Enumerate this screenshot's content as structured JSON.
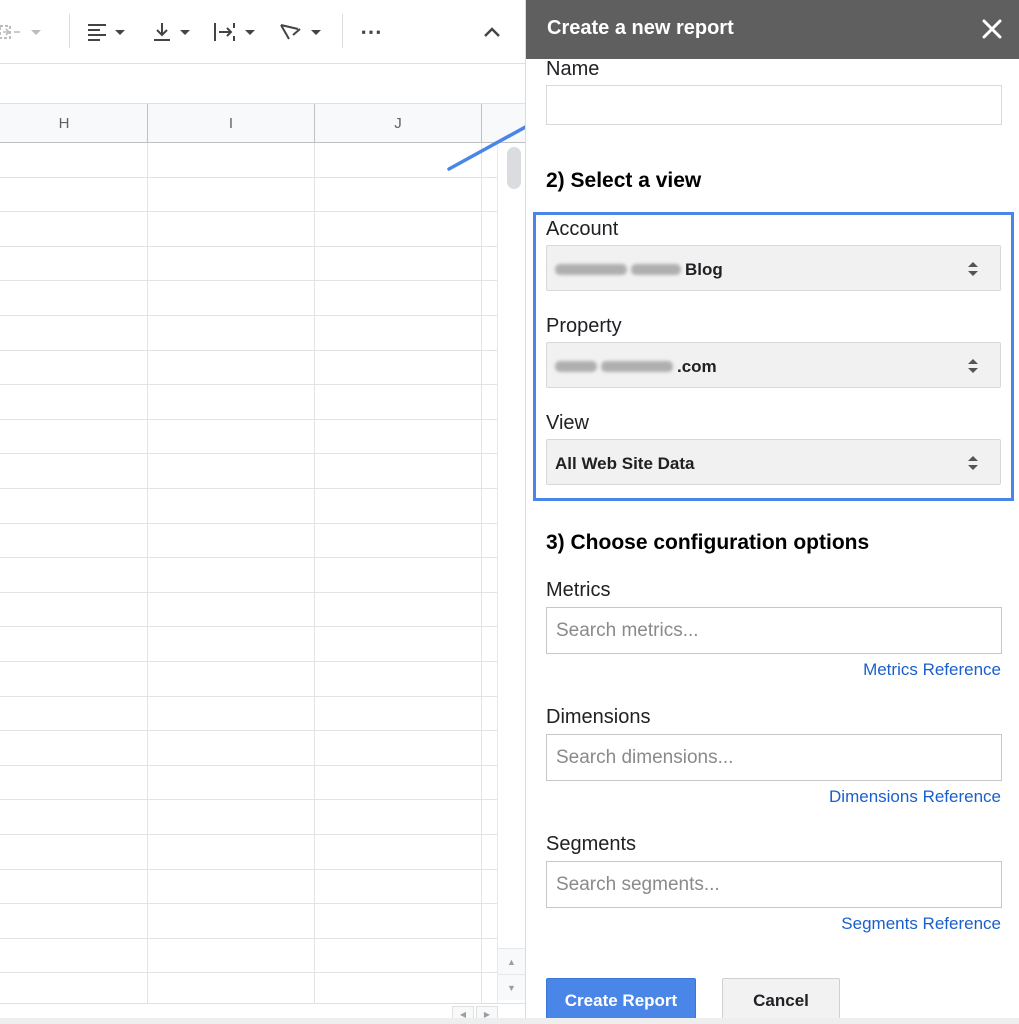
{
  "toolbar": {
    "items": [
      {
        "icon": "merge-cells-icon"
      },
      {
        "icon": "horizontal-align-icon"
      },
      {
        "icon": "vertical-align-icon"
      },
      {
        "icon": "text-wrapping-icon"
      },
      {
        "icon": "text-rotation-icon"
      },
      {
        "icon": "more-options-icon"
      },
      {
        "icon": "collapse-toolbar-icon"
      }
    ],
    "more_label": "⋯"
  },
  "sheet": {
    "columns": [
      "H",
      "I",
      "J"
    ],
    "row_count": 25
  },
  "panel": {
    "title": "Create a new report",
    "close_icon": "close-icon",
    "name": {
      "label": "Name",
      "value": "",
      "placeholder": ""
    },
    "select_view": {
      "heading": "2) Select a view",
      "account": {
        "label": "Account",
        "value_suffix": "Blog",
        "value_redacted": true
      },
      "property": {
        "label": "Property",
        "value_suffix": ".com",
        "value_redacted": true
      },
      "view": {
        "label": "View",
        "value": "All Web Site Data"
      }
    },
    "config": {
      "heading": "3) Choose configuration options",
      "metrics": {
        "label": "Metrics",
        "placeholder": "Search metrics...",
        "reference_link": "Metrics Reference"
      },
      "dimensions": {
        "label": "Dimensions",
        "placeholder": "Search dimensions...",
        "reference_link": "Dimensions Reference"
      },
      "segments": {
        "label": "Segments",
        "placeholder": "Search segments...",
        "reference_link": "Segments Reference"
      }
    },
    "buttons": {
      "create": "Create Report",
      "cancel": "Cancel"
    }
  },
  "colors": {
    "panel_header": "#5f5f5f",
    "highlight_border": "#4a86e8",
    "primary_button": "#4a86e8",
    "link": "#1a5fcc"
  }
}
